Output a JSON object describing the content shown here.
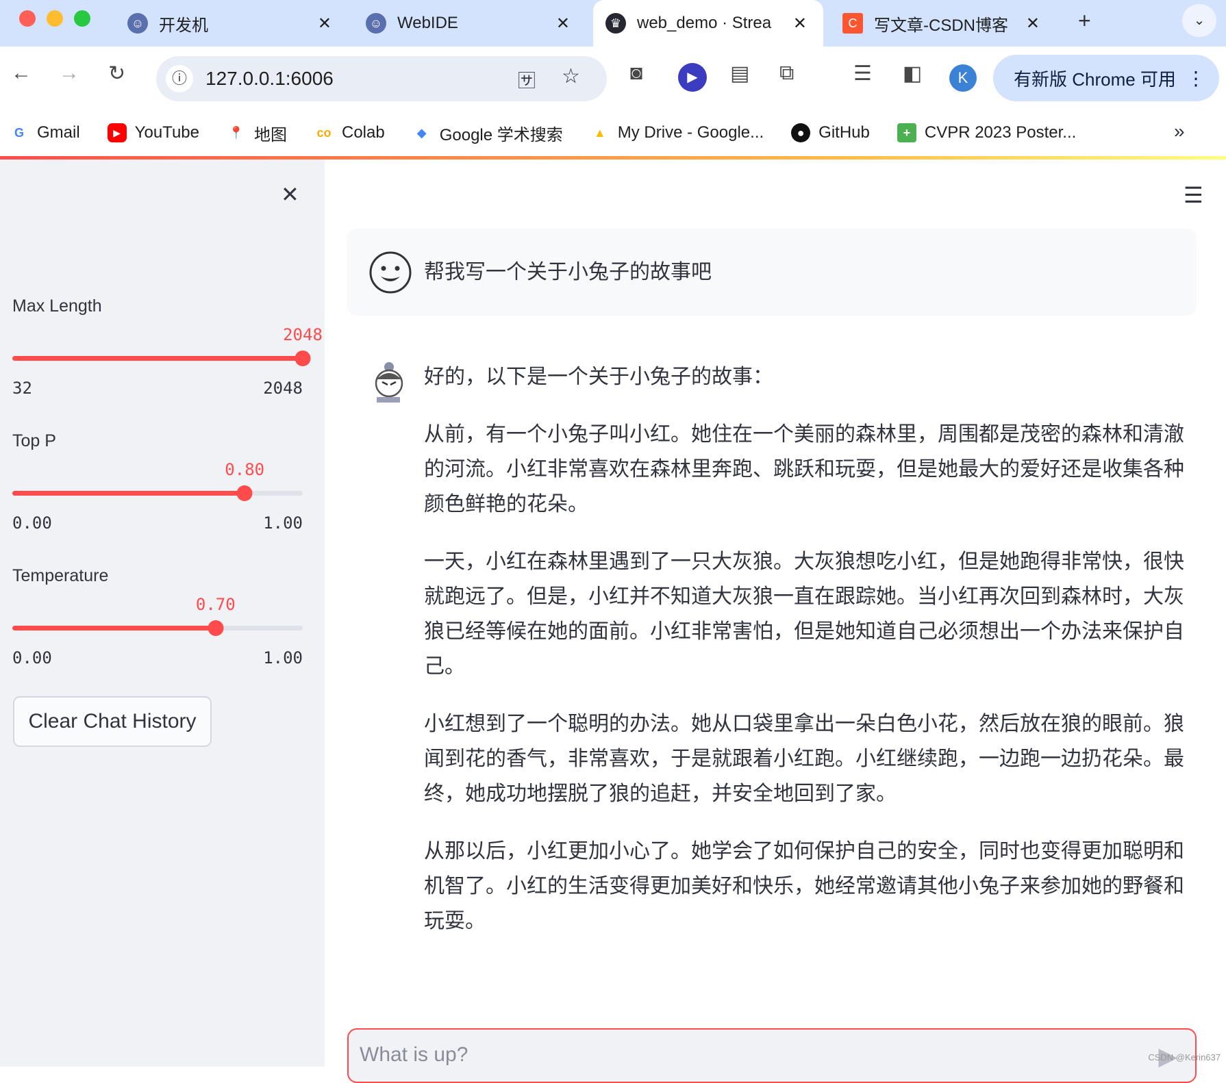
{
  "browser": {
    "tabs": [
      {
        "label": "开发机",
        "icon": "webide-mascot-icon"
      },
      {
        "label": "WebIDE",
        "icon": "webide-mascot-icon"
      },
      {
        "label": "web_demo · Strea",
        "icon": "streamlit-crown-icon",
        "active": true
      },
      {
        "label": "写文章-CSDN博客",
        "icon": "csdn-c-icon"
      }
    ],
    "url": "127.0.0.1:6006",
    "profile_initial": "K",
    "update_label": "有新版 Chrome 可用",
    "bookmarks": [
      "Gmail",
      "YouTube",
      "地图",
      "Colab",
      "Google 学术搜索",
      "My Drive - Google...",
      "GitHub",
      "CVPR 2023 Poster..."
    ]
  },
  "sidebar": {
    "sliders": [
      {
        "label": "Max Length",
        "value": "2048",
        "min": "32",
        "max": "2048",
        "fraction": 1.0
      },
      {
        "label": "Top P",
        "value": "0.80",
        "min": "0.00",
        "max": "1.00",
        "fraction": 0.8
      },
      {
        "label": "Temperature",
        "value": "0.70",
        "min": "0.00",
        "max": "1.00",
        "fraction": 0.7
      }
    ],
    "clear_button": "Clear Chat History"
  },
  "chat": {
    "user_message": "帮我写一个关于小兔子的故事吧",
    "assistant_intro": "好的，以下是一个关于小兔子的故事：",
    "assistant_paragraphs": [
      "从前，有一个小兔子叫小红。她住在一个美丽的森林里，周围都是茂密的森林和清澈的河流。小红非常喜欢在森林里奔跑、跳跃和玩耍，但是她最大的爱好还是收集各种颜色鲜艳的花朵。",
      "一天，小红在森林里遇到了一只大灰狼。大灰狼想吃小红，但是她跑得非常快，很快就跑远了。但是，小红并不知道大灰狼一直在跟踪她。当小红再次回到森林时，大灰狼已经等候在她的面前。小红非常害怕，但是她知道自己必须想出一个办法来保护自己。",
      "小红想到了一个聪明的办法。她从口袋里拿出一朵白色小花，然后放在狼的眼前。狼闻到花的香气，非常喜欢，于是就跟着小红跑。小红继续跑，一边跑一边扔花朵。最终，她成功地摆脱了狼的追赶，并安全地回到了家。",
      "从那以后，小红更加小心了。她学会了如何保护自己的安全，同时也变得更加聪明和机智了。小红的生活变得更加美好和快乐，她经常邀请其他小兔子来参加她的野餐和玩耍。"
    ],
    "input_placeholder": "What is up?"
  },
  "watermark": "CSDN @Kerin637",
  "colors": {
    "accent": "#ff4b4b",
    "sidebar_bg": "#f0f2f6",
    "tabstrip": "#d3e3fd"
  }
}
